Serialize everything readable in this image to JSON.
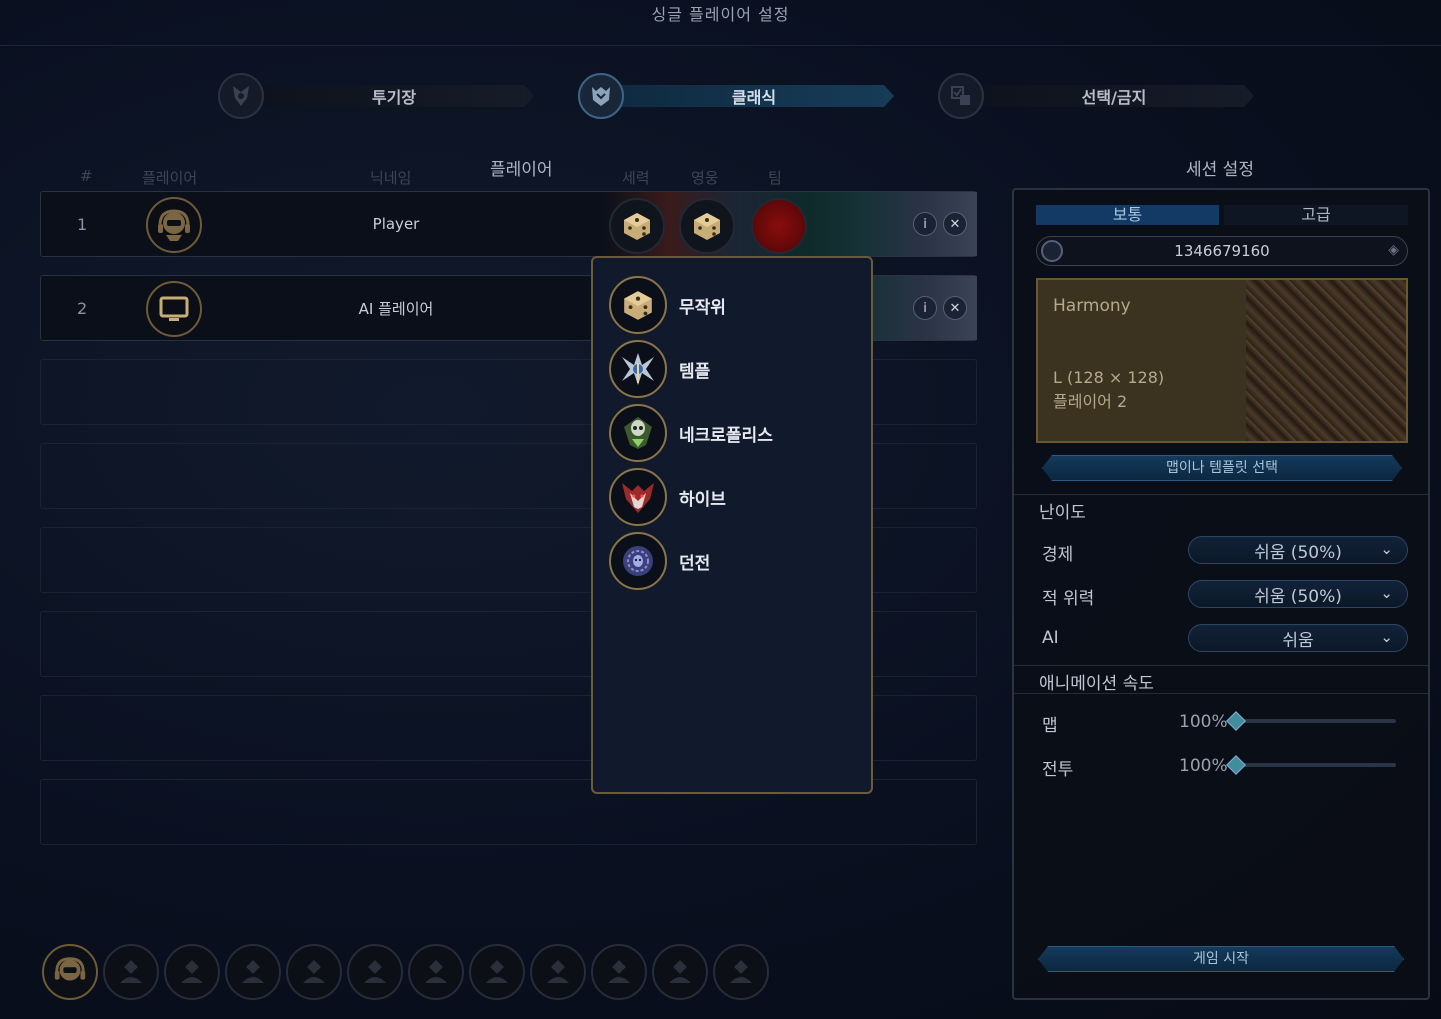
{
  "window": {
    "title": "싱글 플레이어 설정"
  },
  "modes": [
    {
      "label": "투기장",
      "icon": "arena-icon"
    },
    {
      "label": "클래식",
      "icon": "classic-icon",
      "active": true
    },
    {
      "label": "선택/금지",
      "icon": "pick-ban-icon"
    }
  ],
  "table": {
    "section_title": "플레이어",
    "headers": {
      "num": "#",
      "player": "플레이어",
      "nick": "닉네임",
      "faction": "세력",
      "hero": "영웅",
      "team": "팀"
    },
    "rows": [
      {
        "num": "1",
        "nick": "Player",
        "type": "human"
      },
      {
        "num": "2",
        "nick": "AI 플레이어",
        "type": "ai"
      }
    ]
  },
  "faction_dropdown": {
    "items": [
      {
        "label": "무작위",
        "icon": "dice-icon"
      },
      {
        "label": "템플",
        "icon": "temple-crest-icon"
      },
      {
        "label": "네크로폴리스",
        "icon": "necropolis-crest-icon"
      },
      {
        "label": "하이브",
        "icon": "hive-crest-icon"
      },
      {
        "label": "던전",
        "icon": "dungeon-crest-icon"
      }
    ]
  },
  "session": {
    "title": "세션 설정",
    "tabs": [
      "보통",
      "고급"
    ],
    "seed": "1346679160",
    "map": {
      "name": "Harmony",
      "size": "L (128 × 128)",
      "players": "플레이어 2"
    },
    "map_button": "맵이나 템플릿 선택",
    "difficulty": {
      "title": "난이도",
      "economy": {
        "label": "경제",
        "value": "쉬움 (50%)"
      },
      "enemy_power": {
        "label": "적 위력",
        "value": "쉬움 (50%)"
      },
      "ai": {
        "label": "AI",
        "value": "쉬움"
      }
    },
    "animation": {
      "title": "애니메이션 속도",
      "map": {
        "label": "맵",
        "value": "100%",
        "level": 0
      },
      "battle": {
        "label": "전투",
        "value": "100%",
        "level": 0
      }
    },
    "start_button": "게임 시작"
  },
  "colors": {
    "accent_gold": "#8a7547",
    "accent_blue": "#173c58",
    "team_red": "#8a0d0d"
  }
}
